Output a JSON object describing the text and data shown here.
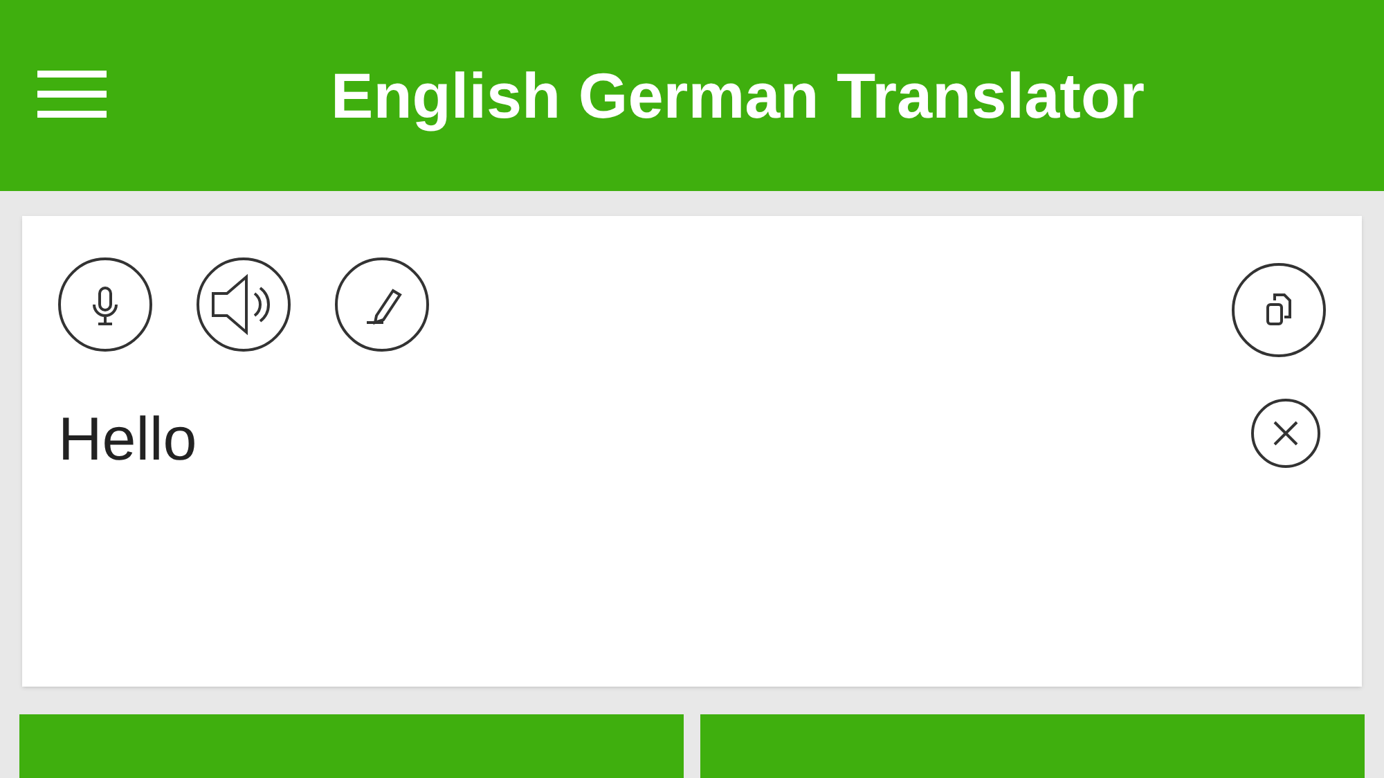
{
  "app_bar": {
    "title": "English German Translator"
  },
  "input": {
    "value": "Hello"
  }
}
